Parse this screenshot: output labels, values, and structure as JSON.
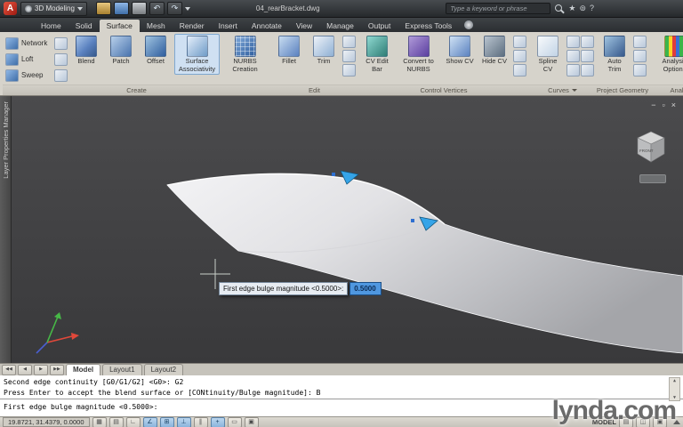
{
  "titlebar": {
    "logo_letter": "A",
    "workspace": "3D Modeling",
    "undo_glyph": "↶",
    "redo_glyph": "↷",
    "filename": "04_rearBracket.dwg",
    "search_placeholder": "Type a keyword or phrase",
    "infocenter_icons": [
      "★",
      "⊚",
      "?"
    ]
  },
  "ribbon": {
    "tabs": [
      "Home",
      "Solid",
      "Surface",
      "Mesh",
      "Render",
      "Insert",
      "Annotate",
      "View",
      "Manage",
      "Output",
      "Express Tools"
    ],
    "active_tab": "Surface",
    "create": {
      "label": "Create",
      "stack": [
        "Network",
        "Loft",
        "Sweep"
      ],
      "blend": "Blend",
      "patch": "Patch",
      "offset": "Offset",
      "assoc": "Surface Associativity",
      "nurbs": "NURBS Creation"
    },
    "edit": {
      "label": "Edit",
      "fillet": "Fillet",
      "trim": "Trim"
    },
    "cv": {
      "label": "Control Vertices",
      "bar": "CV Edit Bar",
      "convert": "Convert to NURBS",
      "show": "Show CV",
      "hide": "Hide CV"
    },
    "curves": {
      "label": "Curves",
      "spline": "Spline CV"
    },
    "proj": {
      "label": "Project Geometry",
      "autotrim": "Auto Trim"
    },
    "analysis": {
      "label": "Analysis",
      "options": "Analysis Options"
    }
  },
  "sidebar": {
    "title": "Layer Properties Manager"
  },
  "viewport": {
    "controls": {
      "minimize": "−",
      "restore": "▫",
      "close": "×"
    },
    "viewcube_label": "FRONT",
    "tooltip_label": "First edge bulge magnitude <0.5000>:",
    "tooltip_value": "0.5000"
  },
  "layout_tabs": {
    "nav": [
      "◀◀",
      "◀",
      "▶",
      "▶▶"
    ],
    "items": [
      "Model",
      "Layout1",
      "Layout2"
    ],
    "active": "Model"
  },
  "command": {
    "line1": "Second edge continuity [G0/G1/G2] <G0>: G2",
    "line2": "Press Enter to accept the blend surface or [CONtinuity/Bulge magnitude]: B",
    "prompt": "First edge bulge magnitude <0.5000>:",
    "scroll_up": "▲",
    "scroll_down": "▼"
  },
  "statusbar": {
    "coords": "19.8721, 31.4379, 0.0000",
    "toggles": [
      {
        "g": "▦",
        "on": false
      },
      {
        "g": "▤",
        "on": false
      },
      {
        "g": "∟",
        "on": false
      },
      {
        "g": "∠",
        "on": true
      },
      {
        "g": "⊞",
        "on": true
      },
      {
        "g": "⊥",
        "on": true
      },
      {
        "g": "∥",
        "on": false
      },
      {
        "g": "+",
        "on": true
      },
      {
        "g": "▭",
        "on": false
      },
      {
        "g": "▣",
        "on": false
      }
    ],
    "model_label": "MODEL",
    "right_icons": [
      "▤",
      "◫",
      "▣"
    ]
  },
  "watermark": "lynda.com"
}
